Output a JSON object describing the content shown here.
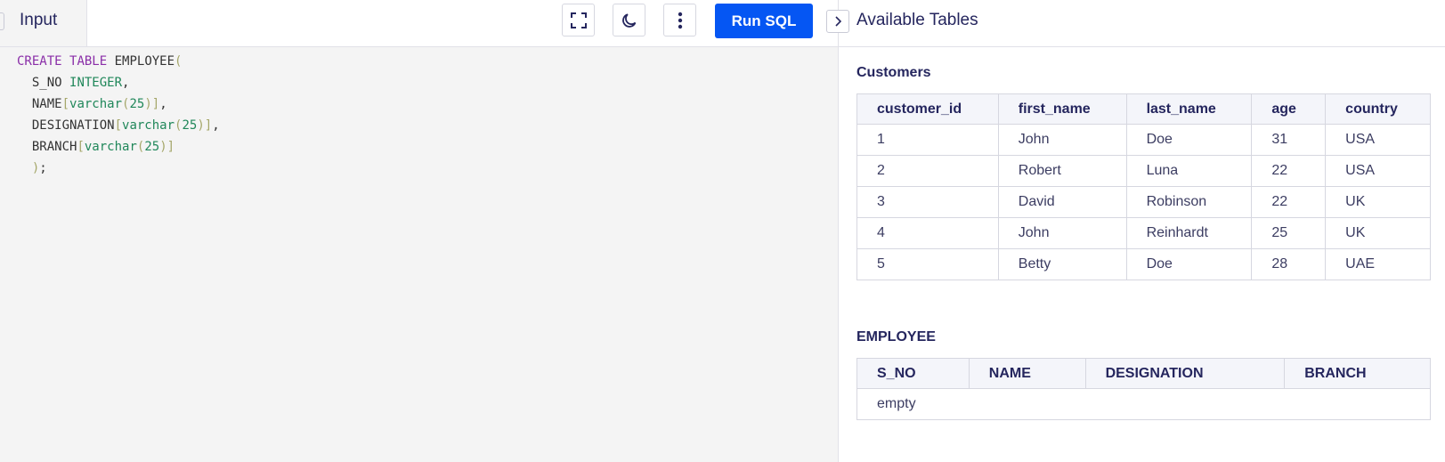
{
  "editor": {
    "tab_label": "Input",
    "run_label": "Run SQL",
    "code": {
      "l1_kw1": "CREATE",
      "l1_kw2": "TABLE",
      "l1_name": "EMPLOYEE",
      "l1_paren": "(",
      "l2_col": "S_NO",
      "l2_type": "INTEGER",
      "l2_comma": ",",
      "l3_col": "NAME",
      "l3_open": "[",
      "l3_type": "varchar",
      "l3_popen": "(",
      "l3_num": "25",
      "l3_pclose": ")",
      "l3_close": "]",
      "l3_comma": ",",
      "l4_col": "DESIGNATION",
      "l4_open": "[",
      "l4_type": "varchar",
      "l4_popen": "(",
      "l4_num": "25",
      "l4_pclose": ")",
      "l4_close": "]",
      "l4_comma": ",",
      "l5_col": "BRANCH",
      "l5_open": "[",
      "l5_type": "varchar",
      "l5_popen": "(",
      "l5_num": "25",
      "l5_pclose": ")",
      "l5_close": "]",
      "l6_paren": ")",
      "l6_semi": ";"
    }
  },
  "icons": {
    "fullscreen": "fullscreen-icon",
    "theme": "moon-icon",
    "more": "more-vertical-icon",
    "collapse": "chevron-right-icon"
  },
  "colors": {
    "accent": "#0556f3",
    "keyword": "#8a2ea8",
    "type": "#20875a",
    "bracket": "#a5a76a",
    "text": "#25265e"
  },
  "panel": {
    "title": "Available Tables",
    "customers": {
      "title": "Customers",
      "headers": [
        "customer_id",
        "first_name",
        "last_name",
        "age",
        "country"
      ],
      "rows": [
        [
          "1",
          "John",
          "Doe",
          "31",
          "USA"
        ],
        [
          "2",
          "Robert",
          "Luna",
          "22",
          "USA"
        ],
        [
          "3",
          "David",
          "Robinson",
          "22",
          "UK"
        ],
        [
          "4",
          "John",
          "Reinhardt",
          "25",
          "UK"
        ],
        [
          "5",
          "Betty",
          "Doe",
          "28",
          "UAE"
        ]
      ]
    },
    "employee": {
      "title": "EMPLOYEE",
      "headers": [
        "S_NO",
        "NAME",
        "DESIGNATION",
        "BRANCH"
      ],
      "empty_text": "empty"
    }
  }
}
